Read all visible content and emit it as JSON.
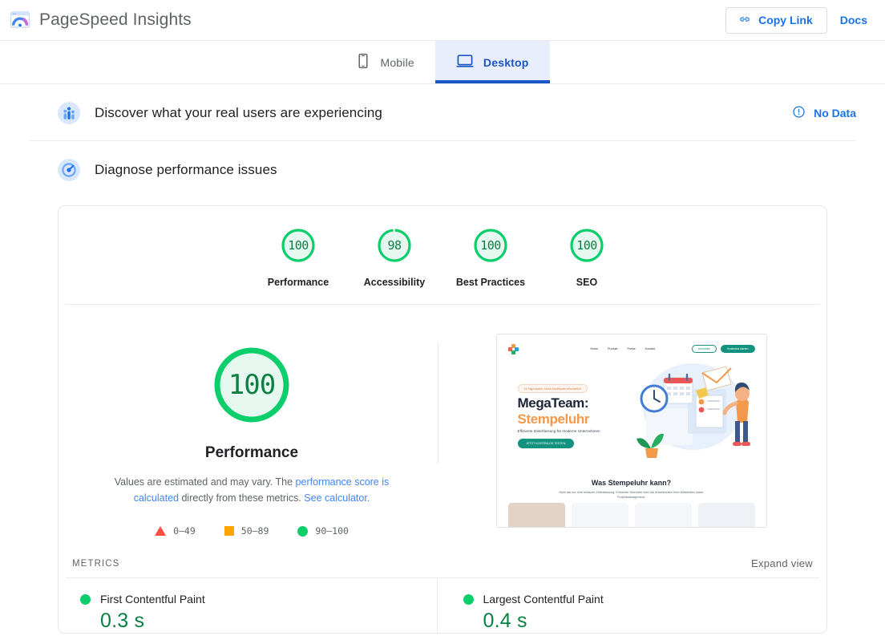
{
  "header": {
    "logo_icon": "pagespeed-logo-icon",
    "title": "PageSpeed Insights",
    "copy_link_label": "Copy Link",
    "copy_link_icon": "link-icon",
    "docs_label": "Docs"
  },
  "tabs": [
    {
      "label": "Mobile",
      "icon": "mobile-icon",
      "active": false
    },
    {
      "label": "Desktop",
      "icon": "desktop-icon",
      "active": true
    }
  ],
  "sections": {
    "field_data": {
      "icon": "real-users-icon",
      "title": "Discover what your real users are experiencing",
      "status_icon": "info-icon",
      "status_label": "No Data"
    },
    "lab_data": {
      "icon": "diagnose-gauge-icon",
      "title": "Diagnose performance issues"
    }
  },
  "category_scores": [
    {
      "label": "Performance",
      "score": "100",
      "value": 100
    },
    {
      "label": "Accessibility",
      "score": "98",
      "value": 98
    },
    {
      "label": "Best Practices",
      "score": "100",
      "value": 100
    },
    {
      "label": "SEO",
      "score": "100",
      "value": 100
    }
  ],
  "performance_detail": {
    "score": "100",
    "value": 100,
    "label": "Performance",
    "disclaimer_part1": "Values are estimated and may vary. The ",
    "disclaimer_link1": "performance score is calculated",
    "disclaimer_part2": " directly from these metrics. ",
    "disclaimer_link2": "See calculator."
  },
  "legend": [
    {
      "shape": "triangle",
      "range": "0–49",
      "color": "#ff4e42"
    },
    {
      "shape": "square",
      "range": "50–89",
      "color": "#ffa400"
    },
    {
      "shape": "circle",
      "range": "90–100",
      "color": "#0cce6b"
    }
  ],
  "screenshot": {
    "alt": "page-screenshot-thumbnail",
    "site": {
      "nav_items": [
        "Home",
        "Produkt",
        "Preise",
        "Kontakt"
      ],
      "nav_button_outline": "Anmelden",
      "nav_button_filled": "Kostenlos starten",
      "badge": "14 Tage testen, keine Kreditkarte erforderlich",
      "heading_line1": "MegaTeam:",
      "heading_line2": "Stempeluhr",
      "subheading": "Effiziente Zeiterfassung für moderne Unternehmen",
      "cta": "JETZT KOSTENLOS TESTEN",
      "section_heading": "Was Stempeluhr kann?",
      "section_text": "Mehr als nur eine einfache Zeiterfassung. Einfacher Überblick über die Arbeitszeiten Ihrer Mitarbeiter sowie Projektmanagement."
    }
  },
  "metrics": {
    "section_title": "METRICS",
    "expand_label": "Expand view",
    "items": [
      {
        "name": "First Contentful Paint",
        "value": "0.3 s",
        "status": "good"
      },
      {
        "name": "Largest Contentful Paint",
        "value": "0.4 s",
        "status": "good"
      }
    ]
  },
  "colors": {
    "brand_blue": "#1a73e8",
    "tab_active": "#1a56c4",
    "good_green": "#0cce6b",
    "good_text": "#0b8043",
    "average_orange": "#ffa400",
    "poor_red": "#ff4e42"
  }
}
